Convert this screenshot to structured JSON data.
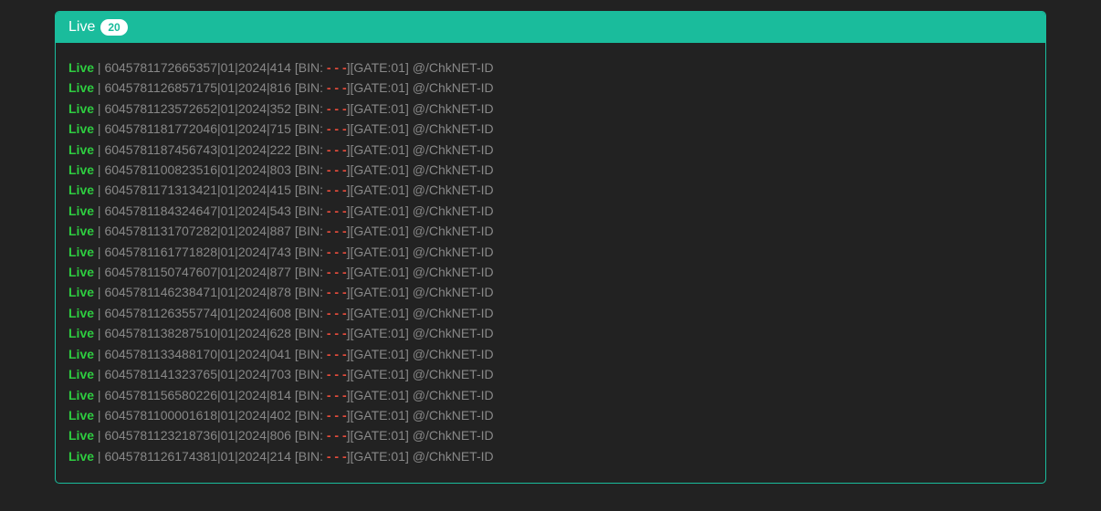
{
  "panel": {
    "title": "Live",
    "count": "20"
  },
  "entries": [
    {
      "status": "Live",
      "card": "6045781172665357|01|2024|414",
      "bin_prefix": "[BIN: ",
      "bin_value": "- - -",
      "suffix": "][GATE:01] @/ChkNET-ID"
    },
    {
      "status": "Live",
      "card": "6045781126857175|01|2024|816",
      "bin_prefix": "[BIN: ",
      "bin_value": "- - -",
      "suffix": "][GATE:01] @/ChkNET-ID"
    },
    {
      "status": "Live",
      "card": "6045781123572652|01|2024|352",
      "bin_prefix": "[BIN: ",
      "bin_value": "- - -",
      "suffix": "][GATE:01] @/ChkNET-ID"
    },
    {
      "status": "Live",
      "card": "6045781181772046|01|2024|715",
      "bin_prefix": "[BIN: ",
      "bin_value": "- - -",
      "suffix": "][GATE:01] @/ChkNET-ID"
    },
    {
      "status": "Live",
      "card": "6045781187456743|01|2024|222",
      "bin_prefix": "[BIN: ",
      "bin_value": "- - -",
      "suffix": "][GATE:01] @/ChkNET-ID"
    },
    {
      "status": "Live",
      "card": "6045781100823516|01|2024|803",
      "bin_prefix": "[BIN: ",
      "bin_value": "- - -",
      "suffix": "][GATE:01] @/ChkNET-ID"
    },
    {
      "status": "Live",
      "card": "6045781171313421|01|2024|415",
      "bin_prefix": "[BIN: ",
      "bin_value": "- - -",
      "suffix": "][GATE:01] @/ChkNET-ID"
    },
    {
      "status": "Live",
      "card": "6045781184324647|01|2024|543",
      "bin_prefix": "[BIN: ",
      "bin_value": "- - -",
      "suffix": "][GATE:01] @/ChkNET-ID"
    },
    {
      "status": "Live",
      "card": "6045781131707282|01|2024|887",
      "bin_prefix": "[BIN: ",
      "bin_value": "- - -",
      "suffix": "][GATE:01] @/ChkNET-ID"
    },
    {
      "status": "Live",
      "card": "6045781161771828|01|2024|743",
      "bin_prefix": "[BIN: ",
      "bin_value": "- - -",
      "suffix": "][GATE:01] @/ChkNET-ID"
    },
    {
      "status": "Live",
      "card": "6045781150747607|01|2024|877",
      "bin_prefix": "[BIN: ",
      "bin_value": "- - -",
      "suffix": "][GATE:01] @/ChkNET-ID"
    },
    {
      "status": "Live",
      "card": "6045781146238471|01|2024|878",
      "bin_prefix": "[BIN: ",
      "bin_value": "- - -",
      "suffix": "][GATE:01] @/ChkNET-ID"
    },
    {
      "status": "Live",
      "card": "6045781126355774|01|2024|608",
      "bin_prefix": "[BIN: ",
      "bin_value": "- - -",
      "suffix": "][GATE:01] @/ChkNET-ID"
    },
    {
      "status": "Live",
      "card": "6045781138287510|01|2024|628",
      "bin_prefix": "[BIN: ",
      "bin_value": "- - -",
      "suffix": "][GATE:01] @/ChkNET-ID"
    },
    {
      "status": "Live",
      "card": "6045781133488170|01|2024|041",
      "bin_prefix": "[BIN: ",
      "bin_value": "- - -",
      "suffix": "][GATE:01] @/ChkNET-ID"
    },
    {
      "status": "Live",
      "card": "6045781141323765|01|2024|703",
      "bin_prefix": "[BIN: ",
      "bin_value": "- - -",
      "suffix": "][GATE:01] @/ChkNET-ID"
    },
    {
      "status": "Live",
      "card": "6045781156580226|01|2024|814",
      "bin_prefix": "[BIN: ",
      "bin_value": "- - -",
      "suffix": "][GATE:01] @/ChkNET-ID"
    },
    {
      "status": "Live",
      "card": "6045781100001618|01|2024|402",
      "bin_prefix": "[BIN: ",
      "bin_value": "- - -",
      "suffix": "][GATE:01] @/ChkNET-ID"
    },
    {
      "status": "Live",
      "card": "6045781123218736|01|2024|806",
      "bin_prefix": "[BIN: ",
      "bin_value": "- - -",
      "suffix": "][GATE:01] @/ChkNET-ID"
    },
    {
      "status": "Live",
      "card": "6045781126174381|01|2024|214",
      "bin_prefix": "[BIN: ",
      "bin_value": "- - -",
      "suffix": "][GATE:01] @/ChkNET-ID"
    }
  ]
}
